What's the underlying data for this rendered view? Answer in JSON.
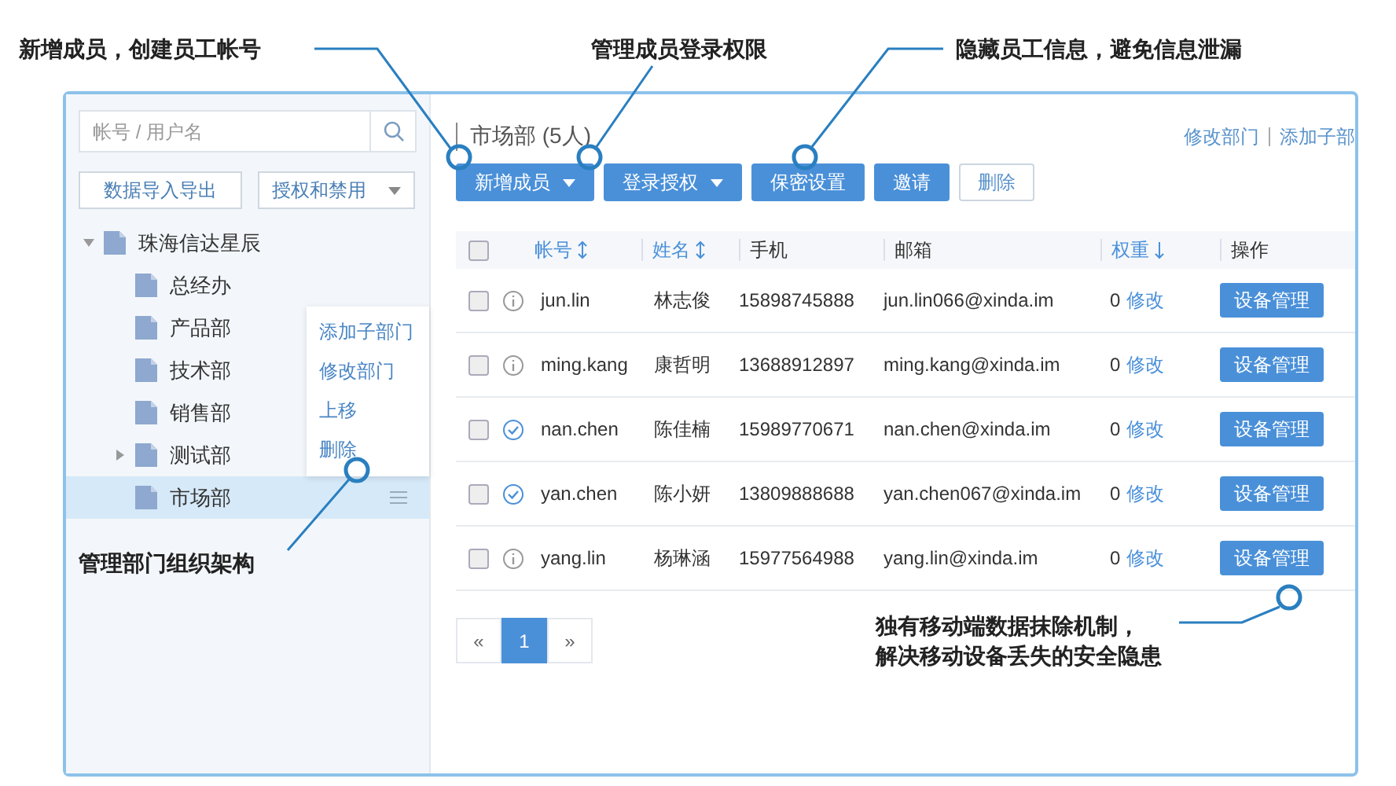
{
  "annotations": [
    {
      "lines": [
        "新增成员，创建员工帐号"
      ]
    },
    {
      "lines": [
        "管理成员登录权限"
      ]
    },
    {
      "lines": [
        "隐藏员工信息，避免信息泄漏"
      ]
    },
    {
      "lines": [
        "管理部门组织架构"
      ]
    },
    {
      "lines": [
        "独有移动端数据抹除机制，",
        "解决移动设备丢失的安全隐患"
      ]
    }
  ],
  "sidebar": {
    "search": {
      "placeholder": "帐号 / 用户名"
    },
    "buttons": [
      {
        "label": "数据导入导出",
        "kind": "plain"
      },
      {
        "label": "授权和禁用",
        "kind": "dropdown"
      }
    ],
    "tree": [
      {
        "label": "珠海信达星辰",
        "expanded": true,
        "selected": false,
        "children": [
          {
            "label": "总经办",
            "selected": false
          },
          {
            "label": "产品部",
            "selected": false
          },
          {
            "label": "技术部",
            "selected": false
          },
          {
            "label": "销售部",
            "selected": false
          },
          {
            "label": "测试部",
            "expanded": false,
            "selected": false
          },
          {
            "label": "市场部",
            "selected": true
          }
        ]
      }
    ],
    "context_menu": [
      "添加子部门",
      "修改部门",
      "上移",
      "删除"
    ]
  },
  "main": {
    "title": "市场部 (5人)",
    "links": [
      "修改部门",
      "添加子部"
    ],
    "toolbar": [
      {
        "label": "新增成员",
        "kind": "dropdown"
      },
      {
        "label": "登录授权",
        "kind": "dropdown"
      },
      {
        "label": "保密设置",
        "kind": "primary"
      },
      {
        "label": "邀请",
        "kind": "primary"
      },
      {
        "label": "删除",
        "kind": "outline"
      }
    ],
    "table": {
      "header_checked": false,
      "columns": [
        {
          "label": "帐号",
          "sortable": true,
          "sorted": false
        },
        {
          "label": "姓名",
          "sortable": true,
          "sorted": false
        },
        {
          "label": "手机",
          "sortable": false,
          "sorted": false
        },
        {
          "label": "邮箱",
          "sortable": false,
          "sorted": false
        },
        {
          "label": "权重",
          "sortable": true,
          "sorted": true
        },
        {
          "label": "操作",
          "sortable": false,
          "sorted": false
        }
      ],
      "rows": [
        {
          "checked": false,
          "verified": false,
          "account": "jun.lin",
          "name": "林志俊",
          "phone": "15898745888",
          "email": "jun.lin066@xinda.im",
          "weight": "0",
          "edit": "修改",
          "action": "设备管理"
        },
        {
          "checked": false,
          "verified": false,
          "account": "ming.kang",
          "name": "康哲明",
          "phone": "13688912897",
          "email": "ming.kang@xinda.im",
          "weight": "0",
          "edit": "修改",
          "action": "设备管理"
        },
        {
          "checked": false,
          "verified": true,
          "account": "nan.chen",
          "name": "陈佳楠",
          "phone": "15989770671",
          "email": "nan.chen@xinda.im",
          "weight": "0",
          "edit": "修改",
          "action": "设备管理"
        },
        {
          "checked": false,
          "verified": true,
          "account": "yan.chen",
          "name": "陈小妍",
          "phone": "13809888688",
          "email": "yan.chen067@xinda.im",
          "weight": "0",
          "edit": "修改",
          "action": "设备管理"
        },
        {
          "checked": false,
          "verified": false,
          "account": "yang.lin",
          "name": "杨琳涵",
          "phone": "15977564988",
          "email": "yang.lin@xinda.im",
          "weight": "0",
          "edit": "修改",
          "action": "设备管理"
        }
      ]
    },
    "pagination": {
      "prev": "«",
      "pages": [
        {
          "label": "1",
          "selected": true
        }
      ],
      "next": "»"
    }
  }
}
